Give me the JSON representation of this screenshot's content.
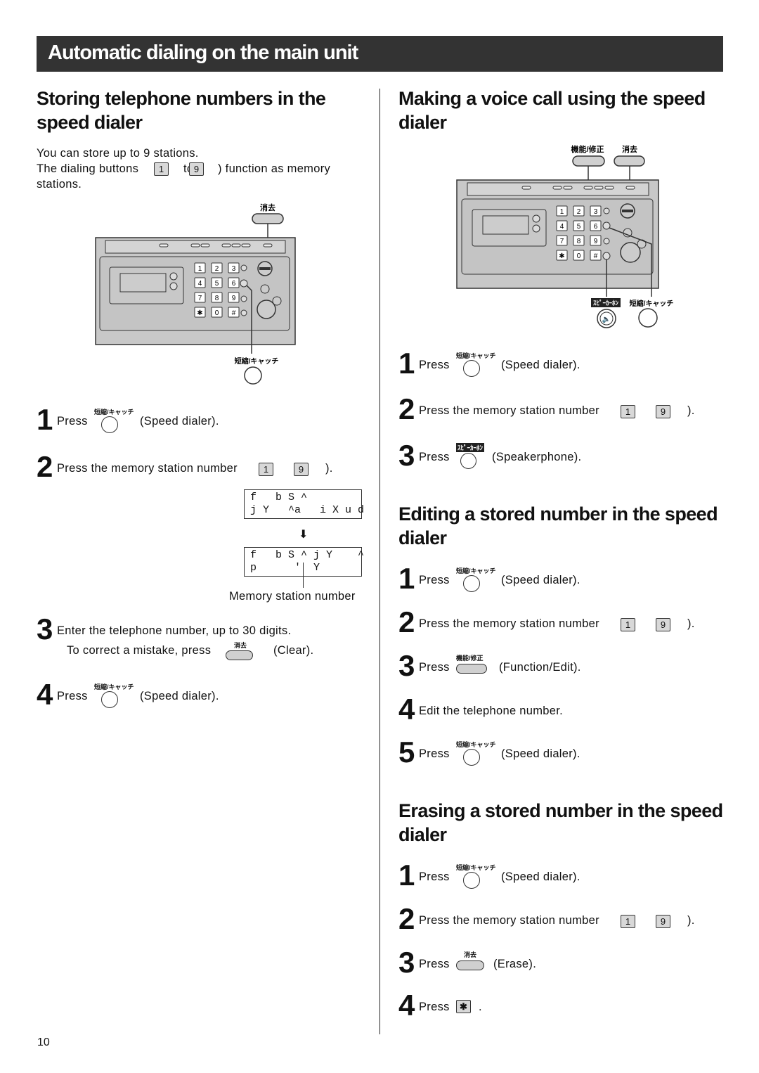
{
  "banner": {
    "title": "Automatic dialing on the main unit"
  },
  "left": {
    "heading": "Storing telephone numbers in the speed dialer",
    "intro_line1": "You can store up to 9 stations.",
    "intro_line2_a": "The dialing buttons",
    "intro_line2_b": "to",
    "intro_line2_c": ") function as memory",
    "intro_line3": "stations.",
    "figure": {
      "clear_label": "消去",
      "speed_label": "短縮/キャッチ",
      "keys": [
        "1",
        "2",
        "3",
        "4",
        "5",
        "6",
        "7",
        "8",
        "9",
        "✱",
        "0",
        "#"
      ]
    },
    "steps": [
      {
        "num": "1",
        "text_a": "Press",
        "key_label": "短縮/キャッチ",
        "text_b": "(Speed dialer)."
      },
      {
        "num": "2",
        "text_a": "Press the memory station number",
        "key_from": "1",
        "key_to": "9",
        "text_b": ")."
      },
      {
        "num": "3",
        "text_a": "Enter the telephone number, up to 30 digits.",
        "sub_a": "To correct a mistake, press",
        "key_label": "消去",
        "sub_b": "(Clear)."
      },
      {
        "num": "4",
        "text_a": "Press",
        "key_label": "短縮/キャッチ",
        "text_b": "(Speed dialer)."
      }
    ],
    "lcd1": {
      "line1": "f   b S ^",
      "line2": "j Y   ^a   i X u d"
    },
    "lcd2": {
      "line1": "f   b S ^ j Y    ^",
      "line2": "p      '  Y"
    },
    "arrow": "⬇",
    "memory_caption": "Memory station number"
  },
  "right": {
    "voice": {
      "heading": "Making a voice call using the speed dialer",
      "figure": {
        "func_label": "機能/修正",
        "clear_label": "消去",
        "speaker_label": "ｽﾋﾟｰｶｰﾎﾝ",
        "speed_label": "短縮/キャッチ",
        "keys": [
          "1",
          "2",
          "3",
          "4",
          "5",
          "6",
          "7",
          "8",
          "9",
          "✱",
          "0",
          "#"
        ]
      },
      "steps": [
        {
          "num": "1",
          "text_a": "Press",
          "key_label": "短縮/キャッチ",
          "text_b": "(Speed dialer)."
        },
        {
          "num": "2",
          "text_a": "Press the memory station number",
          "key_from": "1",
          "key_to": "9",
          "text_b": ")."
        },
        {
          "num": "3",
          "text_a": "Press",
          "key_label": "ｽﾋﾟｰｶｰﾎﾝ",
          "text_b": "(Speakerphone)."
        }
      ]
    },
    "edit": {
      "heading": "Editing a stored number in the speed dialer",
      "steps": [
        {
          "num": "1",
          "text_a": "Press",
          "key_label": "短縮/キャッチ",
          "text_b": "(Speed dialer)."
        },
        {
          "num": "2",
          "text_a": "Press the memory station number",
          "key_from": "1",
          "key_to": "9",
          "text_b": ")."
        },
        {
          "num": "3",
          "text_a": "Press",
          "key_label": "機能/修正",
          "text_b": "(Function/Edit)."
        },
        {
          "num": "4",
          "text_a": "Edit the telephone number."
        },
        {
          "num": "5",
          "text_a": "Press",
          "key_label": "短縮/キャッチ",
          "text_b": "(Speed dialer)."
        }
      ]
    },
    "erase": {
      "heading": "Erasing a stored number in the speed dialer",
      "steps": [
        {
          "num": "1",
          "text_a": "Press",
          "key_label": "短縮/キャッチ",
          "text_b": "(Speed dialer)."
        },
        {
          "num": "2",
          "text_a": "Press the memory station number",
          "key_from": "1",
          "key_to": "9",
          "text_b": ")."
        },
        {
          "num": "3",
          "text_a": "Press",
          "key_label": "消去",
          "text_b": "(Erase)."
        },
        {
          "num": "4",
          "text_a": "Press",
          "key": "✱",
          "text_b": "."
        }
      ]
    }
  },
  "footer": {
    "page_number": "10"
  }
}
